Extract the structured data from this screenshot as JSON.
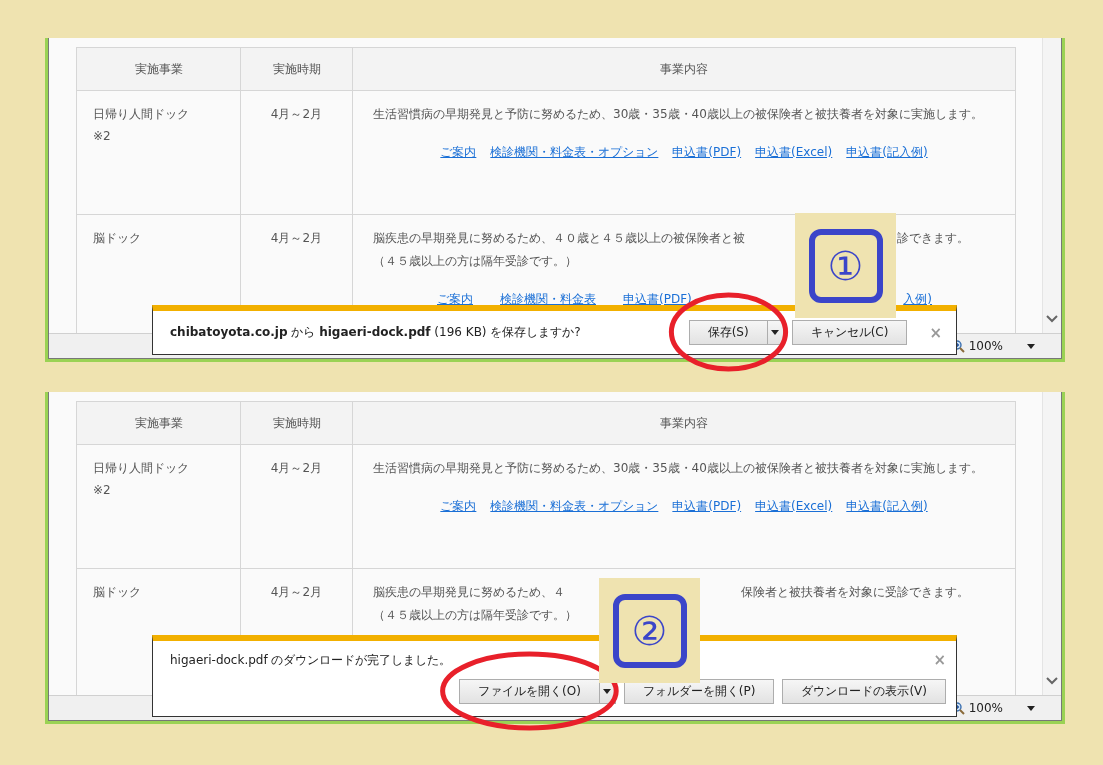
{
  "panels": [
    {
      "step_badge": "①",
      "table": {
        "columns": [
          "実施事業",
          "実施時期",
          "事業内容"
        ],
        "rows": [
          {
            "program": "日帰り人間ドック",
            "note": "※2",
            "period": "4月～2月",
            "description": [
              [
                "生活習慣病の早期発見と予防に努めるため、30歳・35歳・40歳以上の被保険者と被扶養者を対象に実施します。"
              ]
            ],
            "links": [
              [
                "ご案内",
                "検診機関・料金表・オプション",
                "申込書(PDF)",
                "申込書(Excel)",
                "申込書(記入例)"
              ]
            ]
          },
          {
            "program": "脳ドック",
            "period": "4月～2月",
            "description": [
              [
                "脳疾患の早期発見に努めるため、４０歳と４５歳以上の被保険者と被",
                "診できます。"
              ],
              [
                "（４５歳以上の方は隔年受診です。）"
              ]
            ],
            "links": [
              [
                "ご案内",
                "検診機関・料金表",
                "申込書(PDF)"
              ],
              [
                "入例)"
              ]
            ]
          }
        ]
      },
      "notification": {
        "kind": "prompt",
        "message": "**chibatoyota.co.jp** から **higaeri-dock.pdf** (196 KB) を保存しますか?",
        "close": "×",
        "buttons": [
          {
            "label": "保存(S)",
            "split": true,
            "highlighted": true
          },
          {
            "label": "キャンセル(C)",
            "split": false,
            "highlighted": false
          }
        ]
      },
      "zoom": "100%"
    },
    {
      "step_badge": "②",
      "table": {
        "columns": [
          "実施事業",
          "実施時期",
          "事業内容"
        ],
        "rows": [
          {
            "program": "日帰り人間ドック",
            "note": "※2",
            "period": "4月～2月",
            "description": [
              [
                "生活習慣病の早期発見と予防に努めるため、30歳・35歳・40歳以上の被保険者と被扶養者を対象に実施します。"
              ]
            ],
            "links": [
              [
                "ご案内",
                "検診機関・料金表・オプション",
                "申込書(PDF)",
                "申込書(Excel)",
                "申込書(記入例)"
              ]
            ]
          },
          {
            "program": "脳ドック",
            "period": "4月～2月",
            "description": [
              [
                "脳疾患の早期発見に努めるため、４",
                "保険者と被扶養者を対象に受診できます。"
              ],
              [
                "（４５歳以上の方は隔年受診です。）"
              ]
            ]
          }
        ]
      },
      "notification": {
        "kind": "complete",
        "message": "higaeri-dock.pdf のダウンロードが完了しました。",
        "close": "×",
        "buttons": [
          {
            "label": "ファイルを開く(O)",
            "split": true,
            "highlighted": true
          },
          {
            "label": "フォルダーを開く(P)",
            "split": false,
            "highlighted": false
          },
          {
            "label": "ダウンロードの表示(V)",
            "split": false,
            "highlighted": false
          }
        ]
      },
      "zoom": "100%"
    }
  ]
}
